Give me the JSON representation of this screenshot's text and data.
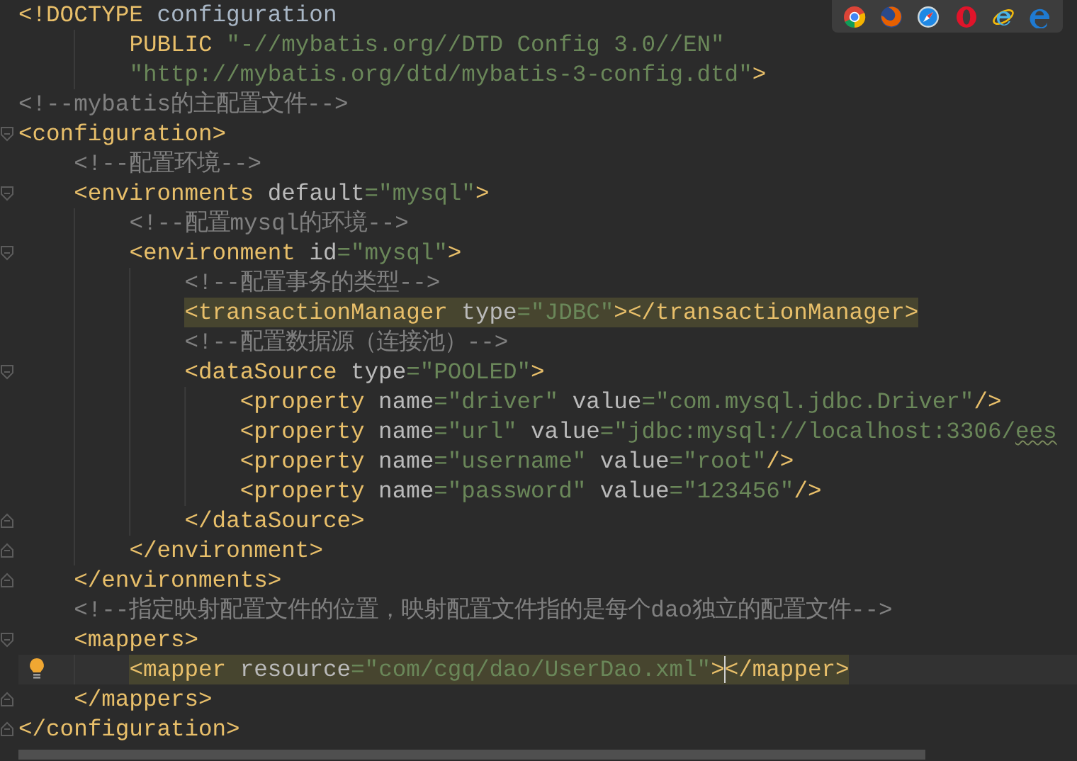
{
  "lines": [
    {
      "tokens": [
        {
          "kind": "tag",
          "text": "<!DOCTYPE"
        },
        {
          "kind": "text",
          "text": " configuration"
        }
      ]
    },
    {
      "tokens": [
        {
          "kind": "tag",
          "text": "        PUBLIC"
        },
        {
          "kind": "value",
          "text": " \"-//mybatis.org//DTD Config 3.0//EN\""
        }
      ]
    },
    {
      "tokens": [
        {
          "kind": "value",
          "text": "        \"http://mybatis.org/dtd/mybatis-3-config.dtd\""
        },
        {
          "kind": "tag",
          "text": ">"
        }
      ]
    },
    {
      "tokens": [
        {
          "kind": "comment",
          "text": "<!--mybatis的主配置文件-->"
        }
      ]
    },
    {
      "fold_open": true,
      "tokens": [
        {
          "kind": "tag",
          "text": "<configuration>"
        }
      ]
    },
    {
      "tokens": [
        {
          "kind": "comment",
          "text": "    <!--配置环境-->"
        }
      ]
    },
    {
      "fold_open": true,
      "tokens": [
        {
          "kind": "tag",
          "text": "    <environments"
        },
        {
          "kind": "attr",
          "text": " default"
        },
        {
          "kind": "value",
          "text": "=\"mysql\""
        },
        {
          "kind": "tag",
          "text": ">"
        }
      ]
    },
    {
      "tokens": [
        {
          "kind": "comment",
          "text": "        <!--配置mysql的环境-->"
        }
      ]
    },
    {
      "fold_open": true,
      "tokens": [
        {
          "kind": "tag",
          "text": "        <environment"
        },
        {
          "kind": "attr",
          "text": " id"
        },
        {
          "kind": "value",
          "text": "=\"mysql\""
        },
        {
          "kind": "tag",
          "text": ">"
        }
      ]
    },
    {
      "tokens": [
        {
          "kind": "comment",
          "text": "            <!--配置事务的类型-->"
        }
      ]
    },
    {
      "highlighted": true,
      "tokens": [
        {
          "kind": "tag",
          "text": "            <transactionManager"
        },
        {
          "kind": "attr",
          "text": " type"
        },
        {
          "kind": "value",
          "text": "=\"JDBC\""
        },
        {
          "kind": "tag",
          "text": "></transactionManager>"
        }
      ]
    },
    {
      "tokens": [
        {
          "kind": "comment",
          "text": "            <!--配置数据源（连接池）-->"
        }
      ]
    },
    {
      "fold_open": true,
      "tokens": [
        {
          "kind": "tag",
          "text": "            <dataSource"
        },
        {
          "kind": "attr",
          "text": " type"
        },
        {
          "kind": "value",
          "text": "=\"POOLED\""
        },
        {
          "kind": "tag",
          "text": ">"
        }
      ]
    },
    {
      "tokens": [
        {
          "kind": "tag",
          "text": "                <property"
        },
        {
          "kind": "attr",
          "text": " name"
        },
        {
          "kind": "value",
          "text": "=\"driver\""
        },
        {
          "kind": "attr",
          "text": " value"
        },
        {
          "kind": "value",
          "text": "=\"com.mysql.jdbc.Driver\""
        },
        {
          "kind": "tag",
          "text": "/>"
        }
      ]
    },
    {
      "tokens": [
        {
          "kind": "tag",
          "text": "                <property"
        },
        {
          "kind": "attr",
          "text": " name"
        },
        {
          "kind": "value",
          "text": "=\"url\""
        },
        {
          "kind": "attr",
          "text": " value"
        },
        {
          "kind": "value",
          "text": "=\"jdbc:mysql://localhost:3306/"
        },
        {
          "kind": "value",
          "text": "ees",
          "typo": true
        }
      ]
    },
    {
      "tokens": [
        {
          "kind": "tag",
          "text": "                <property"
        },
        {
          "kind": "attr",
          "text": " name"
        },
        {
          "kind": "value",
          "text": "=\"username\""
        },
        {
          "kind": "attr",
          "text": " value"
        },
        {
          "kind": "value",
          "text": "=\"root\""
        },
        {
          "kind": "tag",
          "text": "/>"
        }
      ]
    },
    {
      "tokens": [
        {
          "kind": "tag",
          "text": "                <property"
        },
        {
          "kind": "attr",
          "text": " name"
        },
        {
          "kind": "value",
          "text": "=\"password\""
        },
        {
          "kind": "attr",
          "text": " value"
        },
        {
          "kind": "value",
          "text": "=\"123456\""
        },
        {
          "kind": "tag",
          "text": "/>"
        }
      ]
    },
    {
      "fold_close": true,
      "tokens": [
        {
          "kind": "tag",
          "text": "            </dataSource>"
        }
      ]
    },
    {
      "fold_close": true,
      "tokens": [
        {
          "kind": "tag",
          "text": "        </environment>"
        }
      ]
    },
    {
      "fold_close": true,
      "tokens": [
        {
          "kind": "tag",
          "text": "    </environments>"
        }
      ]
    },
    {
      "tokens": [
        {
          "kind": "comment",
          "text": "    <!--指定映射配置文件的位置，映射配置文件指的是每个dao独立的配置文件-->"
        }
      ]
    },
    {
      "fold_open": true,
      "tokens": [
        {
          "kind": "tag",
          "text": "    <mappers>"
        }
      ]
    },
    {
      "current": true,
      "highlighted": true,
      "bulb": true,
      "tokens": [
        {
          "kind": "tag",
          "text": "        <mapper"
        },
        {
          "kind": "attr",
          "text": " resource"
        },
        {
          "kind": "value",
          "text": "=\"com/cgq/dao/UserDao.xml\""
        },
        {
          "kind": "tag",
          "text": ">",
          "caret": true
        },
        {
          "kind": "tag",
          "text": "</mapper>"
        }
      ]
    },
    {
      "fold_close": true,
      "tokens": [
        {
          "kind": "tag",
          "text": "    </mappers>"
        }
      ]
    },
    {
      "fold_close": true,
      "tokens": [
        {
          "kind": "tag",
          "text": "</configuration>"
        }
      ]
    }
  ]
}
